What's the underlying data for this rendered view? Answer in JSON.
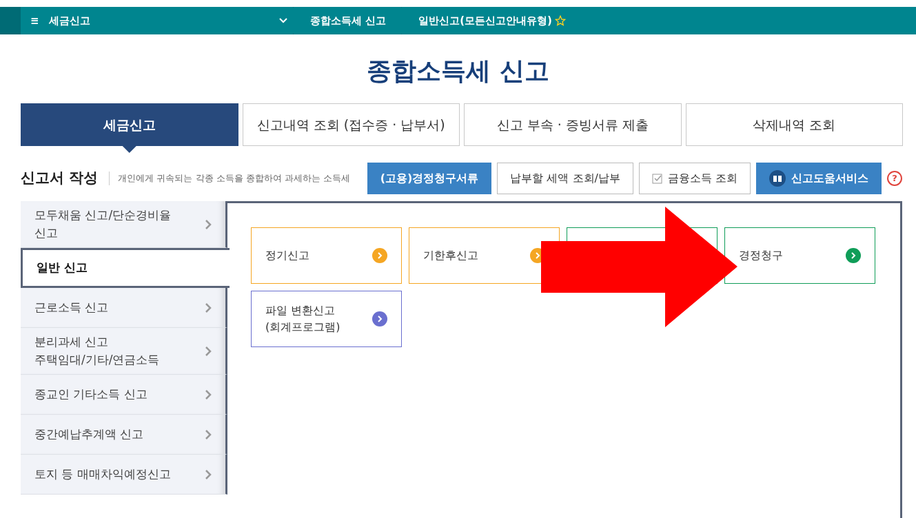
{
  "top_bar": {
    "menu_icon": "≡",
    "menu_label": "세금신고",
    "breadcrumbs": [
      "종합소득세 신고",
      "일반신고(모든신고안내유형)"
    ],
    "favorite": false
  },
  "page_title": "종합소득세 신고",
  "tabs": [
    {
      "label": "세금신고",
      "selected": true
    },
    {
      "label": "신고내역 조회 (접수증 · 납부서)",
      "selected": false
    },
    {
      "label": "신고 부속 · 증빙서류 제출",
      "selected": false
    },
    {
      "label": "삭제내역 조회",
      "selected": false
    }
  ],
  "section": {
    "title": "신고서 작성",
    "description": "개인에게 귀속되는 각종 소득을 종합하여 과세하는 소득세"
  },
  "actions": [
    {
      "label": "(고용)경정청구서류",
      "kind": "primary"
    },
    {
      "label": "납부할 세액 조회/납부",
      "kind": "plain"
    },
    {
      "label": "금융소득 조회",
      "kind": "check"
    },
    {
      "label": "신고도움서비스",
      "kind": "book"
    },
    {
      "label": "?",
      "kind": "help"
    }
  ],
  "sidebar": {
    "items": [
      {
        "label": "모두채움 신고/단순경비율\n신고",
        "selected": false
      },
      {
        "label": "일반 신고",
        "selected": true
      },
      {
        "label": "근로소득 신고",
        "selected": false
      },
      {
        "label": "분리과세 신고\n주택임대/기타/연금소득",
        "selected": false
      },
      {
        "label": "종교인 기타소득 신고",
        "selected": false
      },
      {
        "label": "중간예납추계액 신고",
        "selected": false
      },
      {
        "label": "토지 등 매매차익예정신고",
        "selected": false
      }
    ]
  },
  "cards": [
    {
      "label": "정기신고",
      "color": "#f5a623"
    },
    {
      "label": "기한후신고",
      "color": "#f5a623"
    },
    {
      "color": "#0f9d58",
      "covered": true
    },
    {
      "label": "경정청구",
      "color": "#0f9d58"
    },
    {
      "label": "파일 변환신고\n(회계프로그램)",
      "color": "#6a6fcf"
    }
  ],
  "annotation": {
    "kind": "arrow",
    "color": "#ff0000"
  }
}
